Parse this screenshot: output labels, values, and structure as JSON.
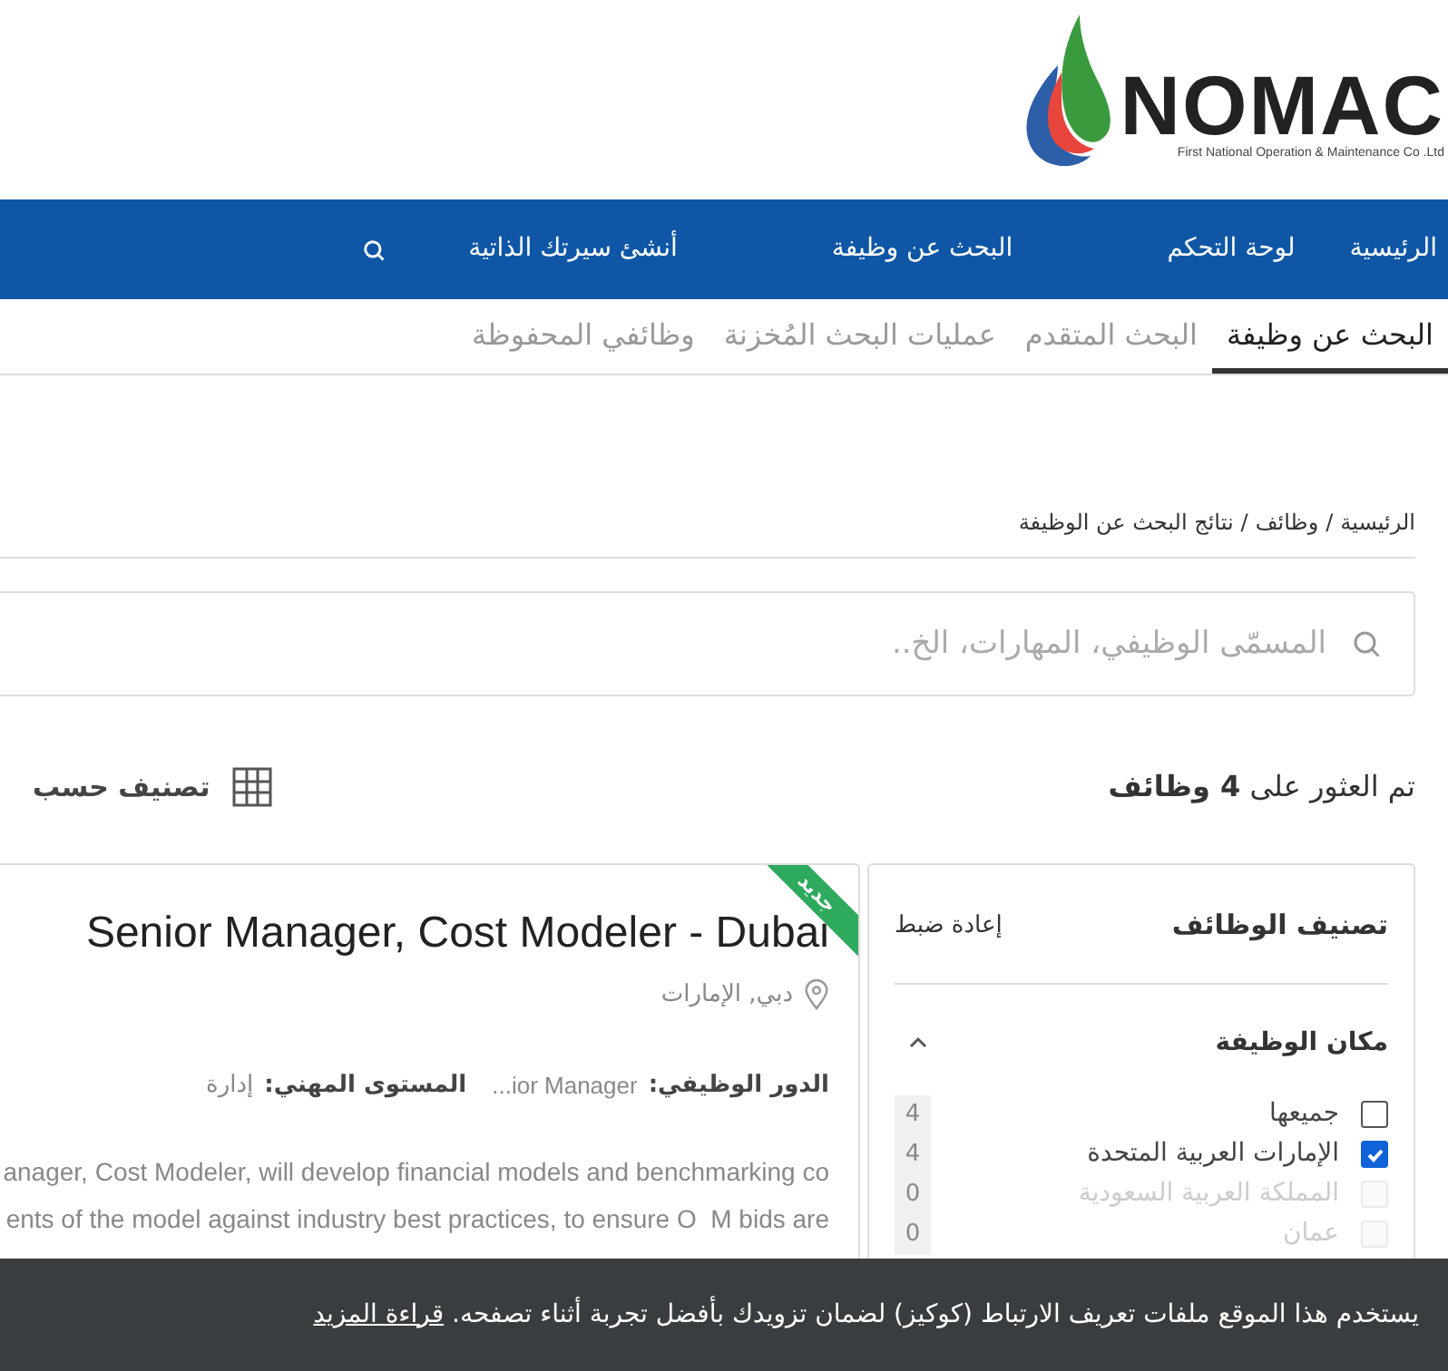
{
  "logo": {
    "name": "NOMAC",
    "tagline": "First National Operation & Maintenance Co .Ltd"
  },
  "nav": {
    "items": [
      {
        "label": "الرئيسية"
      },
      {
        "label": "لوحة التحكم"
      },
      {
        "label": "البحث عن وظيفة"
      },
      {
        "label": "أنشئ سيرتك الذاتية"
      }
    ]
  },
  "tabs": [
    {
      "label": "البحث عن وظيفة",
      "selected": true
    },
    {
      "label": "البحث المتقدم",
      "selected": false
    },
    {
      "label": "عمليات البحث المُخزنة",
      "selected": false
    },
    {
      "label": "وظائفي المحفوظة",
      "selected": false
    }
  ],
  "breadcrumb": {
    "separator": "/",
    "items": [
      "الرئيسية",
      "وظائف",
      "نتائج البحث عن الوظيفة"
    ]
  },
  "search": {
    "placeholder": "المسمّى الوظيفي، المهارات، الخ.."
  },
  "results": {
    "prefix": "تم العثور على",
    "count": "4 وظائف",
    "sort_label": "تصنيف حسب"
  },
  "filters": {
    "title": "تصنيف الوظائف",
    "reset": "إعادة ضبط",
    "section": {
      "title": "مكان الوظيفة",
      "expanded": true,
      "options": [
        {
          "label": "جميعها",
          "count": "4",
          "checked": false,
          "disabled": false
        },
        {
          "label": "الإمارات العربية المتحدة",
          "count": "4",
          "checked": true,
          "disabled": false
        },
        {
          "label": "المملكة العربية السعودية",
          "count": "0",
          "checked": false,
          "disabled": true
        },
        {
          "label": "عمان",
          "count": "0",
          "checked": false,
          "disabled": true
        }
      ]
    }
  },
  "job": {
    "badge": "جديد",
    "title": "Senior Manager, Cost Modeler - Dubai",
    "location": "دبي, الإمارات",
    "role_label": "الدور الوظيفي:",
    "role": "...ior Manager",
    "level_label": "المستوى المهني:",
    "level": "إدارة",
    "description_lines": [
      "anager, Cost Modeler, will develop financial models and benchmarking co",
      "ents of the model against industry best practices, to ensure O  M bids are"
    ]
  },
  "cookie": {
    "text": "يستخدم هذا الموقع ملفات تعريف الارتباط (كوكيز) لضمان تزويدك بأفضل تجربة أثناء تصفحه.",
    "link": "قراءة المزيد"
  }
}
